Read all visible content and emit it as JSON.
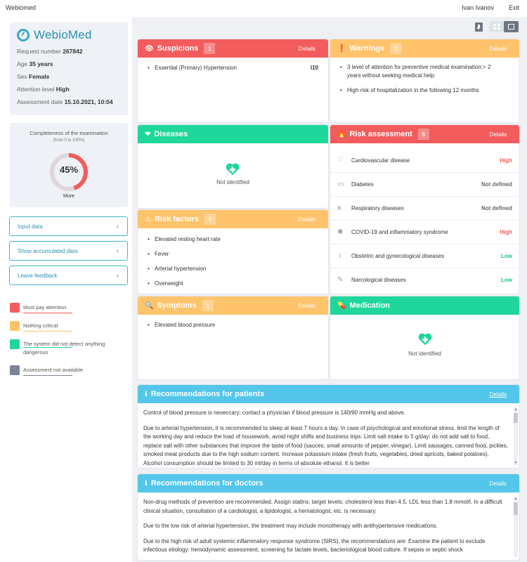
{
  "topbar": {
    "brand": "Webiomed",
    "user": "Ivan Ivanov",
    "exit": "Exit"
  },
  "patient": {
    "logo": "WebioMed",
    "request_label": "Request number",
    "request_value": "267842",
    "age_label": "Age",
    "age_value": "35 years",
    "sex_label": "Sex",
    "sex_value": "Female",
    "attention_label": "Attention level",
    "attention_value": "High",
    "date_label": "Assessment date",
    "date_value": "15.10.2021, 10:04"
  },
  "completeness": {
    "title": "Completeness of the examination",
    "subtitle": "(from 0 to 100%)",
    "percent_text": "45%",
    "percent": 45,
    "more": "More"
  },
  "sidebar_buttons": [
    "Input data",
    "Show accumulated data",
    "Leave feedback"
  ],
  "legend": [
    {
      "label": "Must pay attention",
      "color": "#f25c5c"
    },
    {
      "label": "Nothing critical",
      "color": "#ffc36b"
    },
    {
      "label": "The system did not detect anything dangerous",
      "color": "#1fd69b"
    },
    {
      "label": "Assessment not available",
      "color": "#7c8597"
    }
  ],
  "details": "Details",
  "suspicions": {
    "title": "Suspicions",
    "count": "1",
    "items": [
      {
        "text": "Essential (Primary) Hypertension",
        "code": "I10"
      }
    ]
  },
  "warnings": {
    "title": "Warnings",
    "count": "2",
    "items": [
      "3 level of attention for preventive medical examination:> 2 years without seeking medical help",
      "High risk of hospitalization in the following 12 months"
    ]
  },
  "diseases": {
    "title": "Diseases",
    "empty": "Not identified"
  },
  "risk_assessment": {
    "title": "Risk assessment",
    "count": "6",
    "rows": [
      {
        "name": "Cardiovascular disease",
        "value": "High",
        "color": "#f25c5c",
        "icon": "heart-pulse-icon"
      },
      {
        "name": "Diabetes",
        "value": "Not defined",
        "color": "#666666",
        "icon": "drop-icon"
      },
      {
        "name": "Respiratory diseases",
        "value": "Not defined",
        "color": "#666666",
        "icon": "lungs-icon"
      },
      {
        "name": "COVID-19 and inflammatory syndrome",
        "value": "High",
        "color": "#f25c5c",
        "icon": "virus-icon"
      },
      {
        "name": "Obstetric and gynecological diseases",
        "value": "Low",
        "color": "#1fc28e",
        "icon": "pregnant-icon"
      },
      {
        "name": "Narcological diseases",
        "value": "Low",
        "color": "#1fc28e",
        "icon": "syringe-icon"
      }
    ]
  },
  "risk_factors": {
    "title": "Risk factors",
    "count": "4",
    "items": [
      "Elevated resting heart rate",
      "Fever",
      "Arterial hypertension",
      "Overweight"
    ]
  },
  "symptoms": {
    "title": "Symptoms",
    "count": "1",
    "items": [
      "Elevated blood pressure"
    ]
  },
  "medication": {
    "title": "Medication",
    "empty": "Not identified"
  },
  "rec_patients": {
    "title": "Recommendations for patients",
    "paragraphs": [
      "Control of blood pressure is neseccary; contact a physician if blood pressure is 140/90 mmHg and above.",
      "Due to arterial hypertension, it is recommended to sleep at least 7 hours a day. In case of psychological and emotional stress, limit the length of the working day and reduce the load of housework, avoid night shifts and business trips. Limit salt intake to 5 g/day: do not add salt to food, replace salt with other substances that improve the taste of food (sauces, small amounts of pepper, vinegar). Limit sausages, canned food, pickles, smoked meat products due to the high sodium content. Increase potassium intake (fresh fruits, vegetables, dried apricots, baked potatoes). Alcohol consumption should be limited to 30 ml/day in terms of absolute ethanol. It is better"
    ]
  },
  "rec_doctors": {
    "title": "Recommendations for doctors",
    "paragraphs": [
      "Non-drug methods of prevention are recommended. Assign statins, target levels: cholesterol less than 4.5, LDL less than 1.8 mmol/l. In a difficult clinical situation, consultation of a cardiologist, a lipidologist, a hematologist, etc. is necessary.",
      "Due to the low risk of arterial hypertension, the treatment may include monotherapy with antihypertensive medications.",
      "Due to the high risk of adult systemic inflammatory response syndrome (SIRS), the recommendations are: Examine the patient to exclude infectious etiology: hemodynamic assessment, screening for lactate levels, bacteriological blood culture. If sepsis or septic shock"
    ]
  }
}
